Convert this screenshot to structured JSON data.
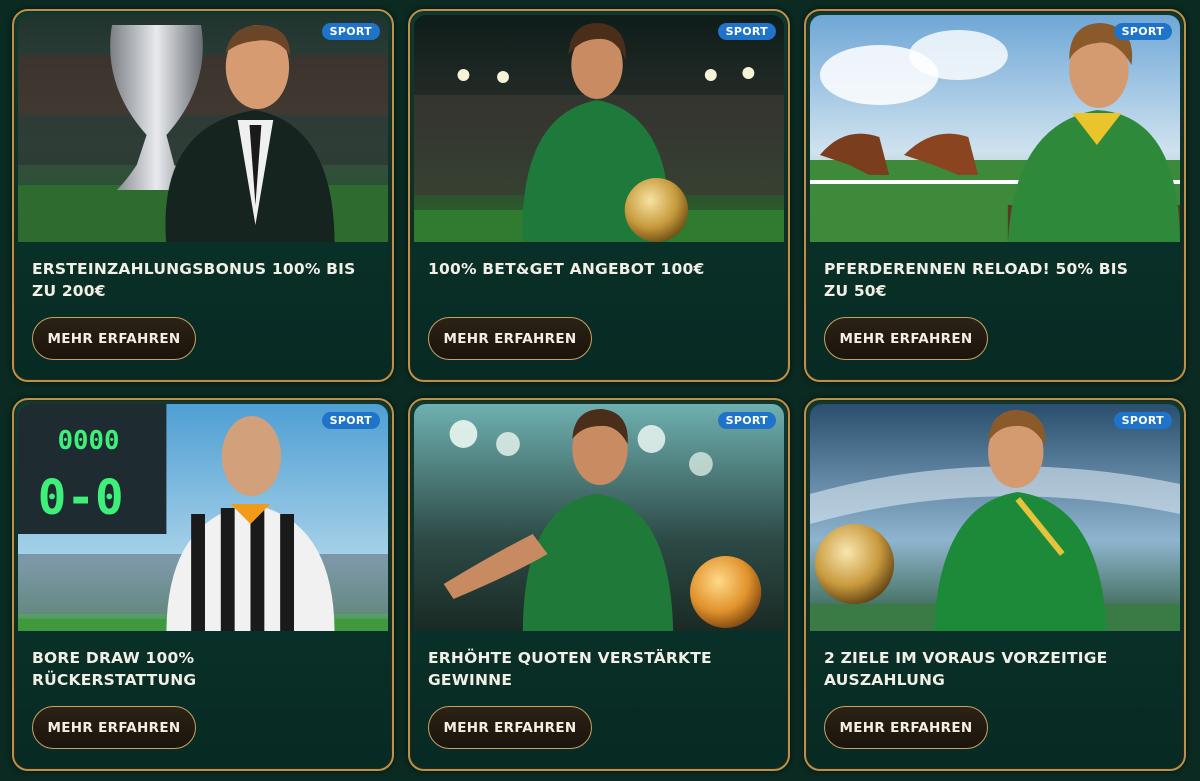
{
  "cards": [
    {
      "badge": "SPORT",
      "title": "ERSTEINZAHLUNGSBONUS 100% BIS ZU 200€",
      "cta": "MEHR ERFAHREN",
      "image": "trophy-man-stadium"
    },
    {
      "badge": "SPORT",
      "title": "100% BET&GET ANGEBOT 100€",
      "cta": "MEHR ERFAHREN",
      "image": "footballer-with-ball"
    },
    {
      "badge": "SPORT",
      "title": "PFERDERENNEN RELOAD! 50% BIS ZU 50€",
      "cta": "MEHR ERFAHREN",
      "image": "horse-racing"
    },
    {
      "badge": "SPORT",
      "title": "BORE DRAW 100% RÜCKERSTATTUNG",
      "cta": "MEHR ERFAHREN",
      "image": "referee-scoreboard"
    },
    {
      "badge": "SPORT",
      "title": "ERHÖHTE QUOTEN VERSTÄRKTE GEWINNE",
      "cta": "MEHR ERFAHREN",
      "image": "basketball-player"
    },
    {
      "badge": "SPORT",
      "title": "2 ZIELE IM VORAUS VORZEITIGE AUSZAHLUNG",
      "cta": "MEHR ERFAHREN",
      "image": "footballer-running"
    }
  ],
  "colors": {
    "accent_gold": "#b8924a",
    "badge_blue": "#1f74c9",
    "card_bg": "#0a3229"
  }
}
